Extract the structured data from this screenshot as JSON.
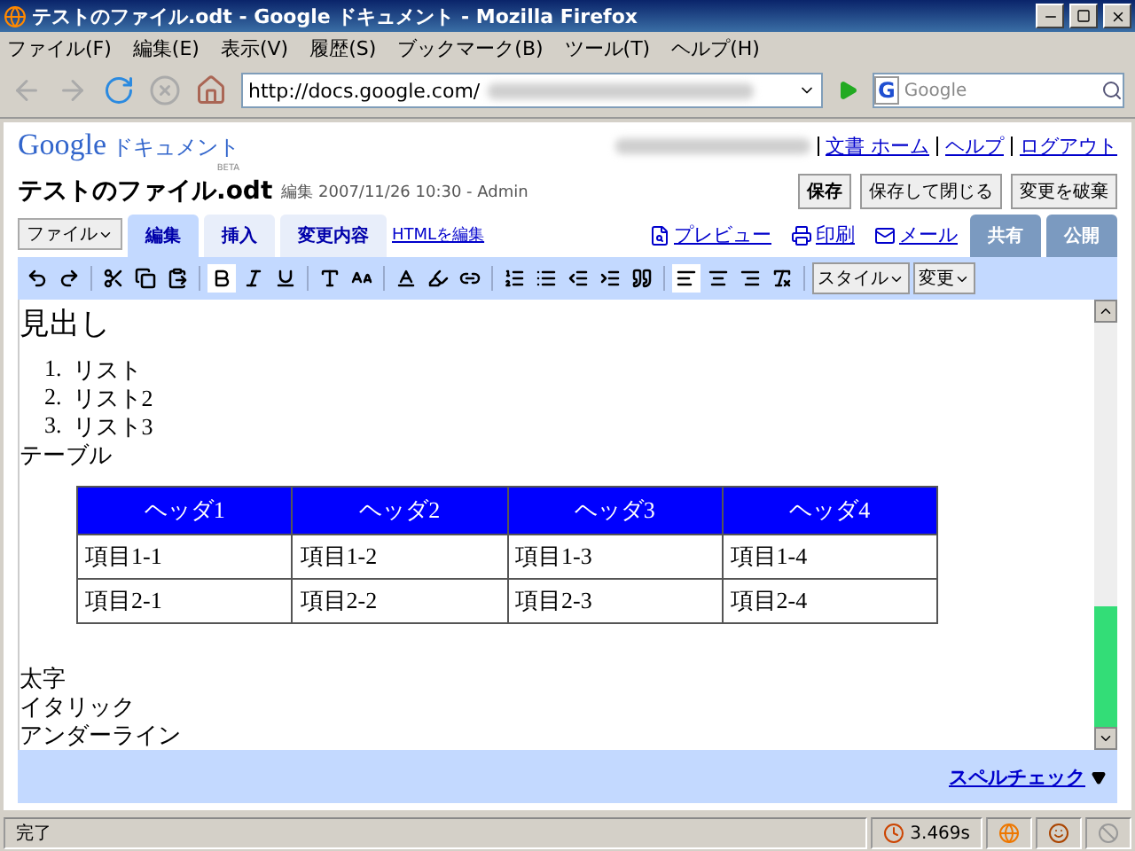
{
  "window": {
    "title": "テストのファイル.odt - Google ドキュメント - Mozilla Firefox"
  },
  "menu": [
    "ファイル(F)",
    "編集(E)",
    "表示(V)",
    "履歴(S)",
    "ブックマーク(B)",
    "ツール(T)",
    "ヘルプ(H)"
  ],
  "address": {
    "url": "http://docs.google.com/"
  },
  "search": {
    "engine": "G",
    "placeholder": "Google"
  },
  "logo": {
    "brand": "Google",
    "product": "ドキュメント",
    "badge": "BETA"
  },
  "user_links": [
    "文書 ホーム",
    "ヘルプ",
    "ログアウト"
  ],
  "doc": {
    "name": "テストのファイル.odt",
    "meta": "編集 2007/11/26 10:30 - Admin"
  },
  "doc_buttons": [
    {
      "label": "保存",
      "primary": true
    },
    {
      "label": "保存して閉じる",
      "primary": false
    },
    {
      "label": "変更を破棄",
      "primary": false
    }
  ],
  "file_menu": "ファイル",
  "tabs": [
    {
      "label": "編集",
      "selected": true
    },
    {
      "label": "挿入",
      "selected": false
    },
    {
      "label": "変更内容",
      "selected": false
    }
  ],
  "html_link": "HTMLを編集",
  "actions": [
    {
      "kind": "preview",
      "label": "プレビュー"
    },
    {
      "kind": "print",
      "label": "印刷"
    },
    {
      "kind": "mail",
      "label": "メール"
    }
  ],
  "share_tabs": [
    "共有",
    "公開"
  ],
  "toolbar": [
    {
      "kind": "undo",
      "active": false
    },
    {
      "kind": "redo",
      "active": false
    },
    {
      "kind": "sep"
    },
    {
      "kind": "cut",
      "active": false
    },
    {
      "kind": "copy",
      "active": false
    },
    {
      "kind": "paste",
      "active": false
    },
    {
      "kind": "sep"
    },
    {
      "kind": "bold",
      "active": true
    },
    {
      "kind": "italic",
      "active": false
    },
    {
      "kind": "underline",
      "active": false
    },
    {
      "kind": "sep"
    },
    {
      "kind": "font",
      "active": false
    },
    {
      "kind": "size",
      "active": false
    },
    {
      "kind": "sep"
    },
    {
      "kind": "color",
      "active": false
    },
    {
      "kind": "highlight",
      "active": false
    },
    {
      "kind": "link",
      "active": false
    },
    {
      "kind": "sep"
    },
    {
      "kind": "numbered",
      "active": false
    },
    {
      "kind": "bullets",
      "active": false
    },
    {
      "kind": "outdent",
      "active": false
    },
    {
      "kind": "indent",
      "active": false
    },
    {
      "kind": "quote",
      "active": false
    },
    {
      "kind": "sep"
    },
    {
      "kind": "left",
      "active": true
    },
    {
      "kind": "center",
      "active": false
    },
    {
      "kind": "right",
      "active": false
    },
    {
      "kind": "clear",
      "active": false
    }
  ],
  "dropdowns": [
    "スタイル",
    "変更"
  ],
  "editor": {
    "heading": "見出し",
    "list": [
      "リスト",
      "リスト2",
      "リスト3"
    ],
    "list_numbers": [
      "1.",
      "2.",
      "3."
    ],
    "caption": "テーブル",
    "table": {
      "columns": [
        "ヘッダ1",
        "ヘッダ2",
        "ヘッダ3",
        "ヘッダ4"
      ],
      "rows": [
        [
          "項目1-1",
          "項目1-2",
          "項目1-3",
          "項目1-4"
        ],
        [
          "項目2-1",
          "項目2-2",
          "項目2-3",
          "項目2-4"
        ]
      ]
    },
    "lines": [
      "太字",
      "イタリック",
      "アンダーライン"
    ]
  },
  "spellcheck": "スペルチェック",
  "status": {
    "text": "完了",
    "timer": "3.469s"
  }
}
